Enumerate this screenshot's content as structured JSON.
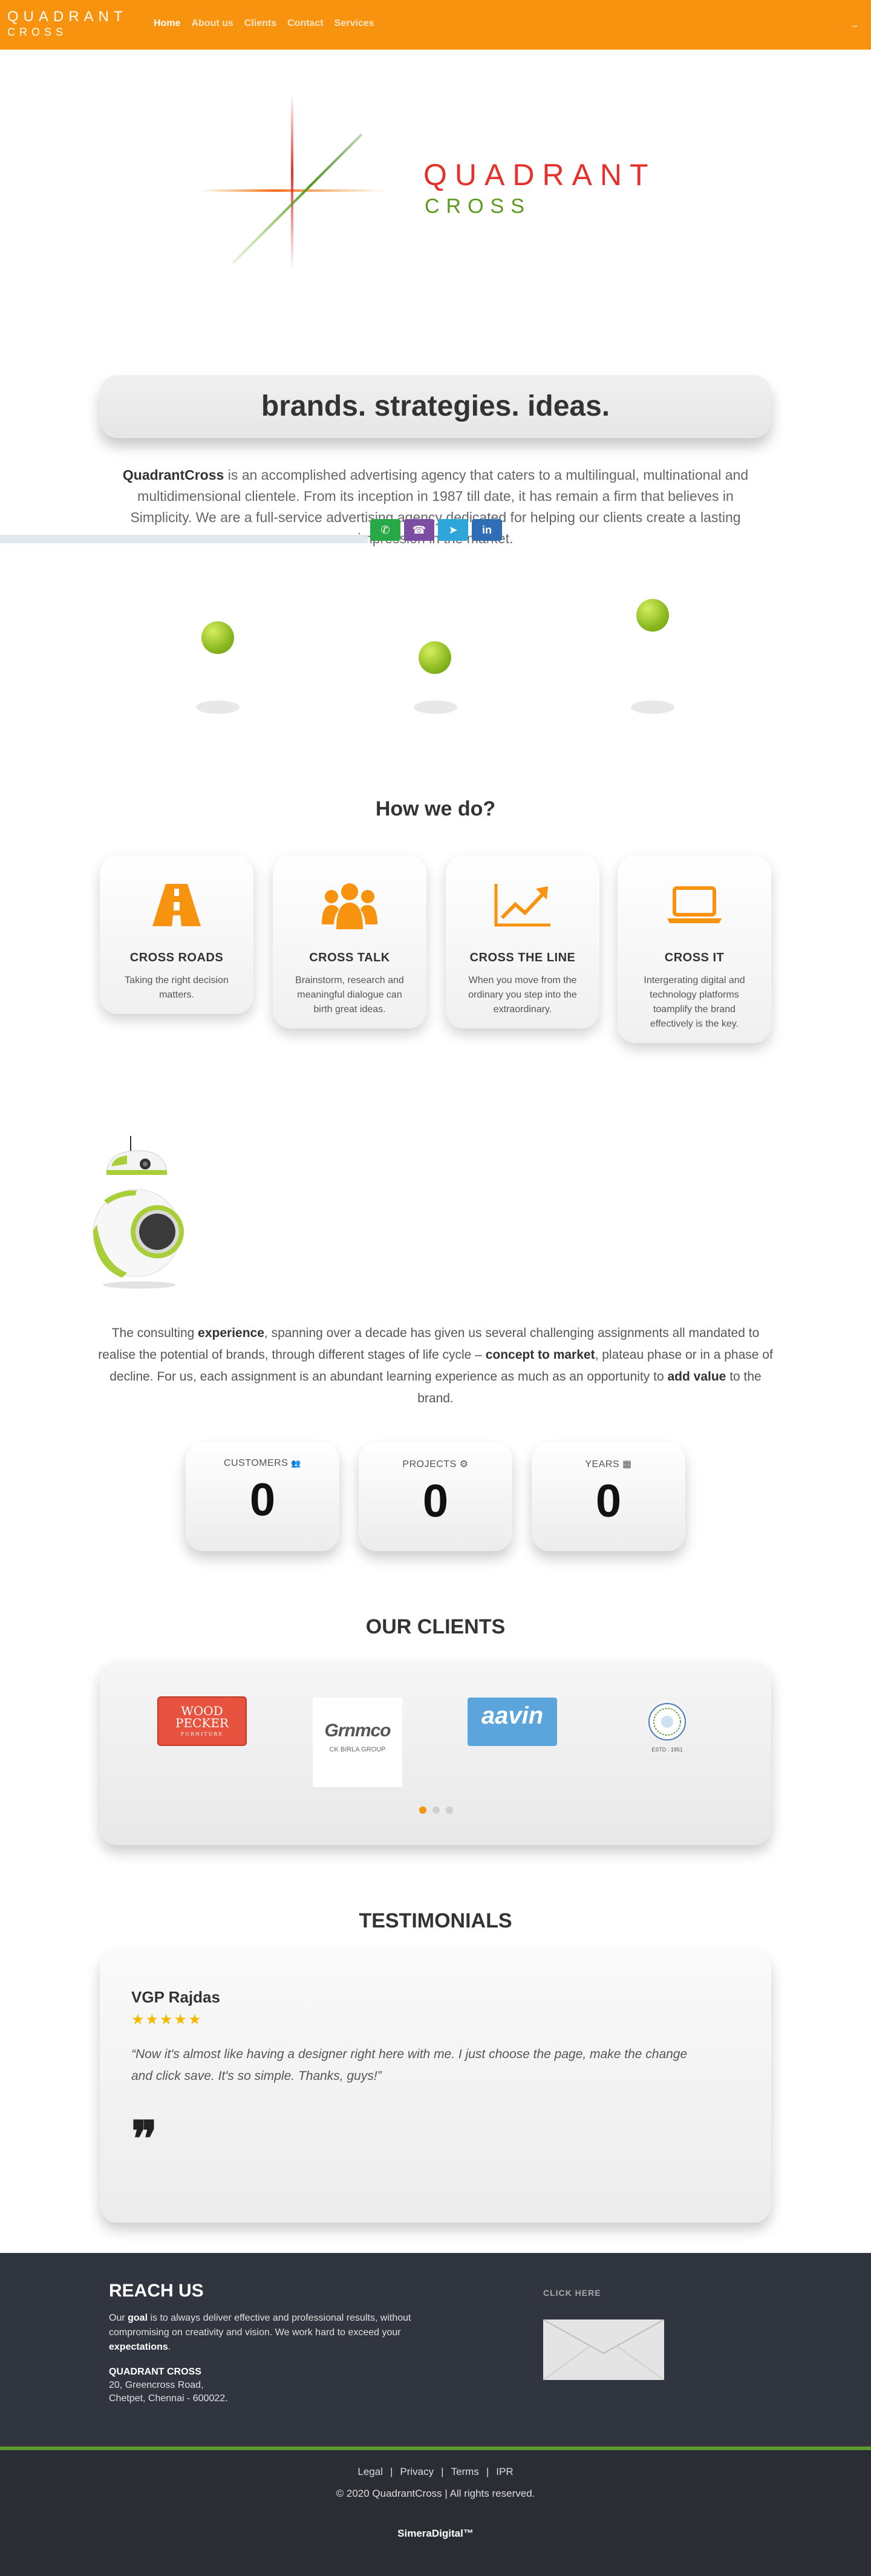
{
  "nav": {
    "logo_line1": "QUADRANT",
    "logo_line2": "CROSS",
    "links": [
      {
        "label": "Home",
        "active": true
      },
      {
        "label": "About us",
        "active": false
      },
      {
        "label": "Clients",
        "active": false
      },
      {
        "label": "Contact",
        "active": false
      },
      {
        "label": "Services",
        "active": false
      }
    ],
    "toggle_icon": "→"
  },
  "hero": {
    "logo_word1": "QUADRANT",
    "logo_word2": "CROSS"
  },
  "tagline": "brands. strategies. ideas.",
  "intro": {
    "brand": "QuadrantCross",
    "text": " is an accomplished advertising agency that caters to a multilingual, multinational and multidimensional clientele. From its inception in 1987 till date, it has remain a firm that believes in Simplicity. We are a full-service advertising agency dedicated for helping our clients create a lasting impression in the market."
  },
  "share": [
    {
      "name": "whatsapp",
      "glyph": "✆",
      "color": "#29a847"
    },
    {
      "name": "viber",
      "glyph": "☎",
      "color": "#7b4da3"
    },
    {
      "name": "telegram",
      "glyph": "➤",
      "color": "#2ea6d9"
    },
    {
      "name": "linkedin",
      "glyph": "in",
      "color": "#2f6db5"
    }
  ],
  "how": {
    "title": "How we do?",
    "cards": [
      {
        "icon": "road-icon",
        "title": "CROSS ROADS",
        "text": "Taking the right decision matters."
      },
      {
        "icon": "users-icon",
        "title": "CROSS TALK",
        "text": "Brainstorm, research and meaningful dialogue can birth great ideas."
      },
      {
        "icon": "chart-line-icon",
        "title": "CROSS THE LINE",
        "text": "When you move from the ordinary you step into the extraordinary."
      },
      {
        "icon": "laptop-icon",
        "title": "CROSS IT",
        "text": "Intergerating digital and technology platforms toamplify the brand effectively is the key."
      }
    ]
  },
  "experience": {
    "p1": "The consulting ",
    "b1": "experience",
    "p2": ", spanning over a decade has given us several challenging assignments all mandated to realise the potential of brands, through different stages of life cycle – ",
    "b2": "concept to market",
    "p3": ", plateau phase or in a phase of decline. For us, each assignment is an abundant learning experience as much as an opportunity to ",
    "b3": "add value",
    "p4": " to the brand."
  },
  "stats": [
    {
      "label": "CUSTOMERS",
      "icon": "users-icon",
      "glyph": "👥",
      "value": "0"
    },
    {
      "label": "PROJECTS",
      "icon": "gear-icon",
      "glyph": "⚙",
      "value": "0"
    },
    {
      "label": "YEARS",
      "icon": "calendar-icon",
      "glyph": "▦",
      "value": "0"
    }
  ],
  "clients": {
    "title": "OUR CLIENTS",
    "logos": [
      {
        "name": "woodpecker",
        "line1": "WOOD",
        "line2": "PECKER",
        "sub": "FURNITURE"
      },
      {
        "name": "grinmco",
        "line1": "Grnmco",
        "line2": "CK BIRLA GROUP"
      },
      {
        "name": "aavin",
        "line1": "aavin"
      },
      {
        "name": "college-seal",
        "line1": "ESTD : 1951"
      }
    ],
    "slides": 3,
    "active_slide": 0
  },
  "testimonials": {
    "title": "TESTIMONIALS",
    "name": "VGP Rajdas",
    "stars": "★★★★★",
    "rating": 4.5,
    "quote": "“Now it's almost like having a designer right here with me. I just choose the page, make the change and click save. It's so simple. Thanks, guys!”",
    "quote_mark": "❞"
  },
  "footer": {
    "reach_title": "REACH US",
    "reach_p1": "Our ",
    "reach_b1": "goal",
    "reach_p2": " is to always deliver effective and professional results, without compromising on creativity and vision. We work hard to exceed your ",
    "reach_b2": "expectations",
    "reach_p3": ".",
    "company": "QUADRANT CROSS",
    "address1": "20, Greencross Road,",
    "address2": "Chetpet, Chennai - 600022.",
    "click_here": "CLICK HERE",
    "legal": [
      "Legal",
      "Privacy",
      "Terms",
      "IPR"
    ],
    "separator": "|",
    "copyright": "© 2020 QuadrantCross | All rights reserved.",
    "credit": "SimeraDigital™"
  },
  "colors": {
    "brand_orange": "#f7930f",
    "logo_red": "#e8302a",
    "logo_green": "#5a9a1e",
    "footer_dark": "#31353f"
  }
}
